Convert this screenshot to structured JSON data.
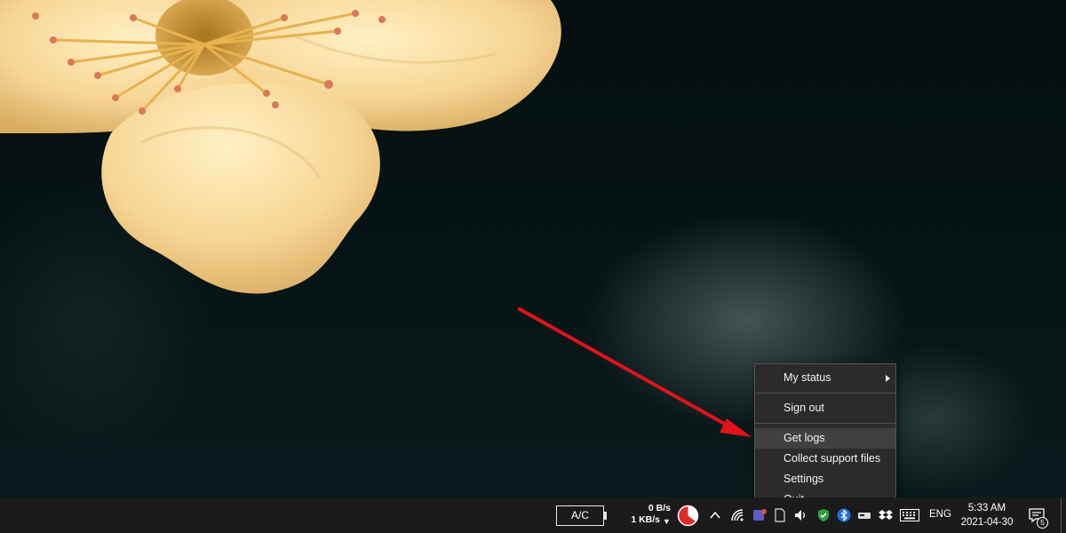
{
  "context_menu": {
    "items": [
      {
        "label": "My status",
        "has_submenu": true
      },
      {
        "label": "Sign out"
      },
      {
        "label": "Get logs",
        "highlighted": true
      },
      {
        "label": "Collect support files"
      },
      {
        "label": "Settings"
      },
      {
        "label": "Quit"
      }
    ]
  },
  "taskbar": {
    "power_badge": "A/C",
    "net_speed": {
      "up": "0 B/s",
      "down": "1 KB/s",
      "down_arrow": "▼"
    },
    "tray_icons": [
      "pie-chart-icon",
      "chevron-up-icon",
      "wifi-icon",
      "app-icon",
      "document-icon",
      "volume-icon",
      "shield-icon",
      "bluetooth-icon",
      "drive-icon",
      "dropbox-icon",
      "keyboard-icon"
    ],
    "language": "ENG",
    "clock": {
      "time": "5:33 AM",
      "date": "2021-04-30"
    },
    "notification_count": "5"
  },
  "colors": {
    "annotation_arrow": "#e0141b",
    "menu_background": "#2b2b2b",
    "menu_highlight": "#414141",
    "taskbar_background": "#1b1b1b"
  }
}
